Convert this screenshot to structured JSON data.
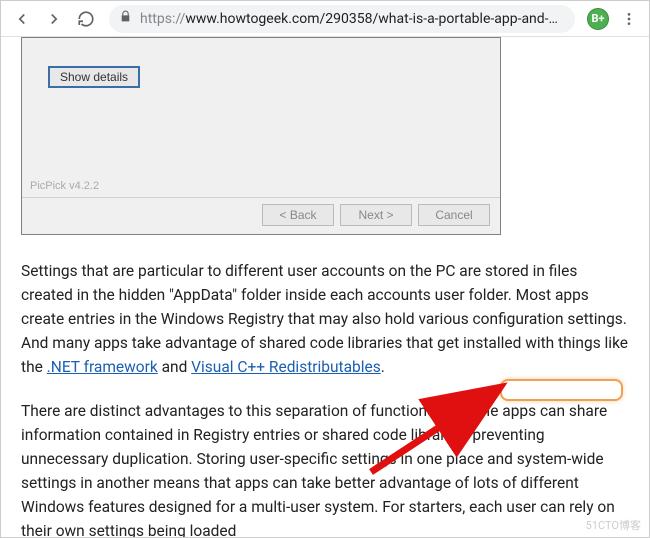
{
  "toolbar": {
    "url_protocol": "https://",
    "url_rest": "www.howtogeek.com/290358/what-is-a-portable-app-and-…",
    "ext_badge": "B+"
  },
  "installer": {
    "show_details": "Show details",
    "picpick": "PicPick v4.2.2",
    "back": "< Back",
    "next": "Next >",
    "cancel": "Cancel"
  },
  "article": {
    "p1_a": "Settings that are particular to different user accounts on the PC are stored in files created in the hidden \"AppData\" folder inside each accounts user folder. Most apps create entries in the Windows Registry that may also hold various configuration settings. And many apps take advantage of shared code libraries that get installed with things like the ",
    "link_net": ".NET framework",
    "p1_b": " and ",
    "link_vc": "Visual C++ Redistributables",
    "p1_c": ".",
    "p2": "There are distinct advantages to this separation of functions. Multiple apps can share information contained in Registry entries or shared code libraries, preventing unnecessary duplication. Storing user-specific settings in one place and system-wide settings in another means that apps can take better advantage of lots of different Windows features designed for a multi-user system. For starters, each user can rely on their own settings being loaded"
  },
  "watermark": "51CTO博客"
}
